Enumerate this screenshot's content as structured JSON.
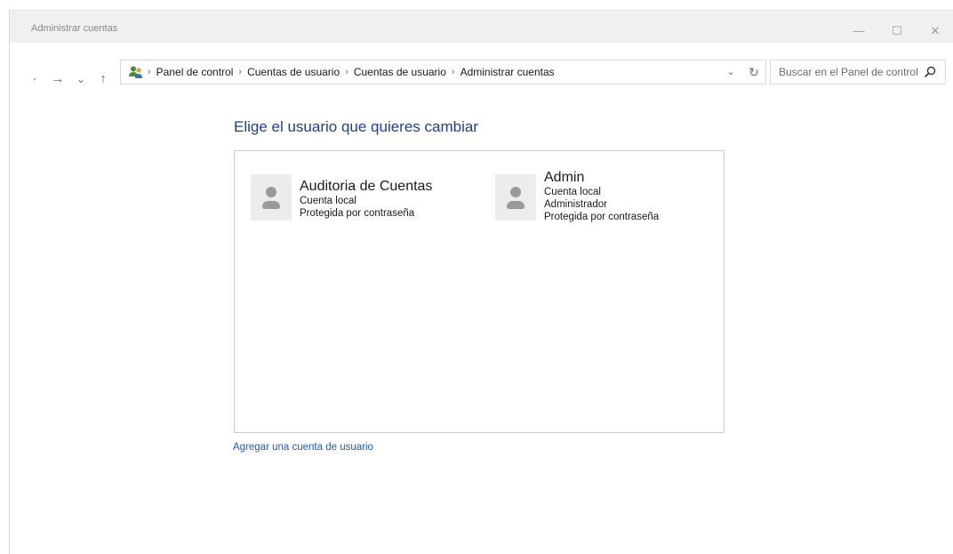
{
  "window": {
    "title": "Administrar cuentas",
    "controls": {
      "minimize": "—",
      "maximize": "☐",
      "close": "✕"
    }
  },
  "nav": {
    "back": "·",
    "forward": "→",
    "recent": "⌄",
    "up": "↑"
  },
  "address": {
    "breadcrumbs": [
      "Panel de control",
      "Cuentas de usuario",
      "Cuentas de usuario",
      "Administrar cuentas"
    ],
    "separator": "›",
    "dropdown": "⌄",
    "refresh": "↻"
  },
  "search": {
    "placeholder": "Buscar en el Panel de control"
  },
  "main": {
    "heading": "Elige el usuario que quieres cambiar",
    "accounts": [
      {
        "name": "Auditoria de Cuentas",
        "details": [
          "Cuenta local",
          "Protegida por contraseña"
        ]
      },
      {
        "name": "Admin",
        "details": [
          "Cuenta local",
          "Administrador",
          "Protegida por contraseña"
        ]
      }
    ],
    "add_account_link": "Agregar una cuenta de usuario"
  },
  "colors": {
    "heading": "#1e3f8c",
    "link": "#1e5bb8",
    "titlebar_bg": "#f0f0f0",
    "avatar_bg": "#ececec",
    "avatar_fg": "#9a9a9a"
  }
}
